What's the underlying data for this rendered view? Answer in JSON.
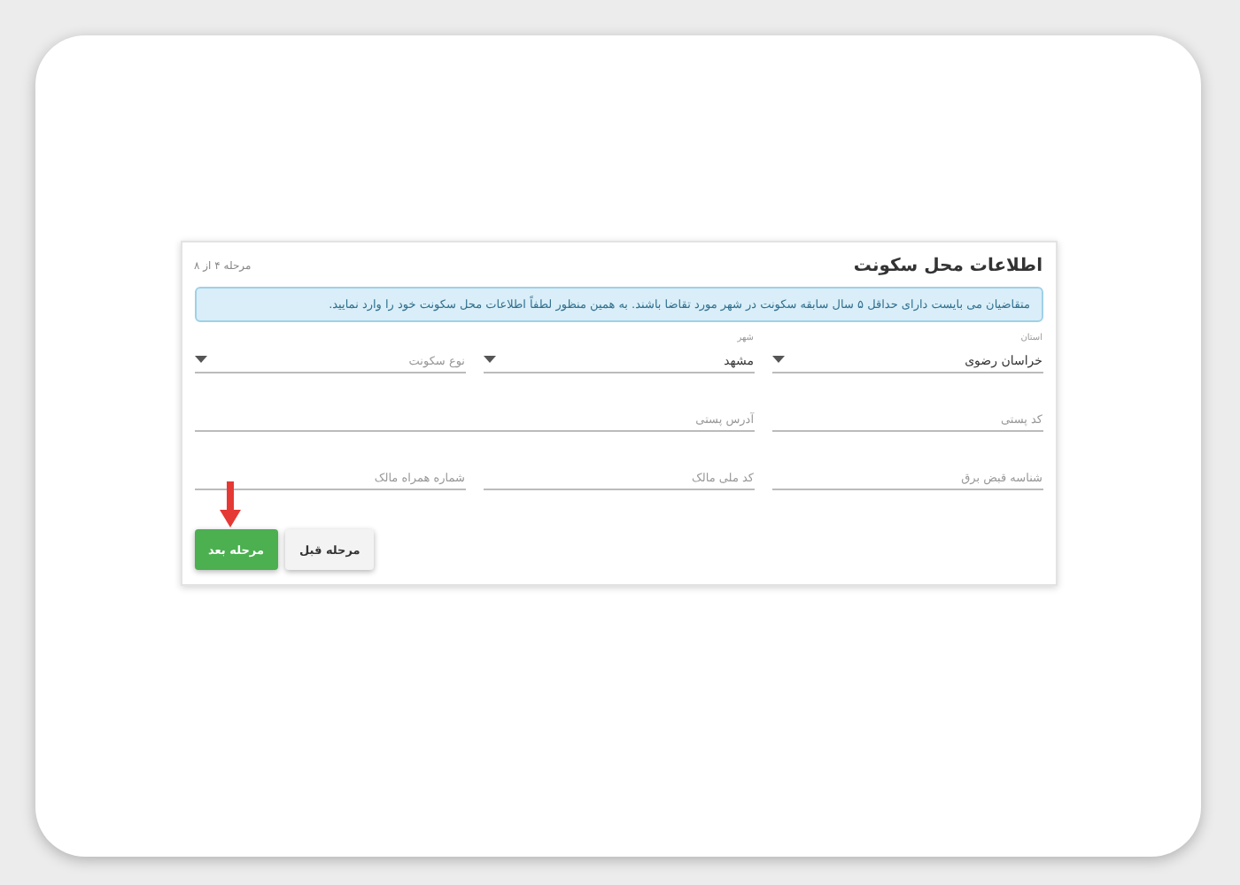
{
  "form": {
    "title": "اطلاعات محل سکونت",
    "step": "مرحله ۴ از ۸",
    "notice": "متقاضیان می بایست دارای حداقل ۵ سال سابقه سکونت در شهر مورد تقاضا باشند. به همین منظور لطفاً اطلاعات محل سکونت خود را وارد نمایید.",
    "rows": [
      [
        {
          "kind": "select",
          "label": "استان",
          "value": "خراسان رضوی"
        },
        {
          "kind": "select",
          "label": "شهر",
          "value": "مشهد"
        },
        {
          "kind": "select",
          "placeholder": "نوع سکونت"
        }
      ],
      [
        {
          "kind": "input",
          "placeholder": "کد پستی"
        },
        {
          "kind": "input",
          "placeholder": "آدرس پستی",
          "wide": true
        }
      ],
      [
        {
          "kind": "input",
          "placeholder": "شناسه قبض برق"
        },
        {
          "kind": "input",
          "placeholder": "کد ملی مالک"
        },
        {
          "kind": "input",
          "placeholder": "شماره همراه مالک"
        }
      ]
    ],
    "buttons": [
      {
        "label": "مرحله قبل",
        "primary": false
      },
      {
        "label": "مرحله بعد",
        "primary": true,
        "pointer": true
      }
    ]
  }
}
